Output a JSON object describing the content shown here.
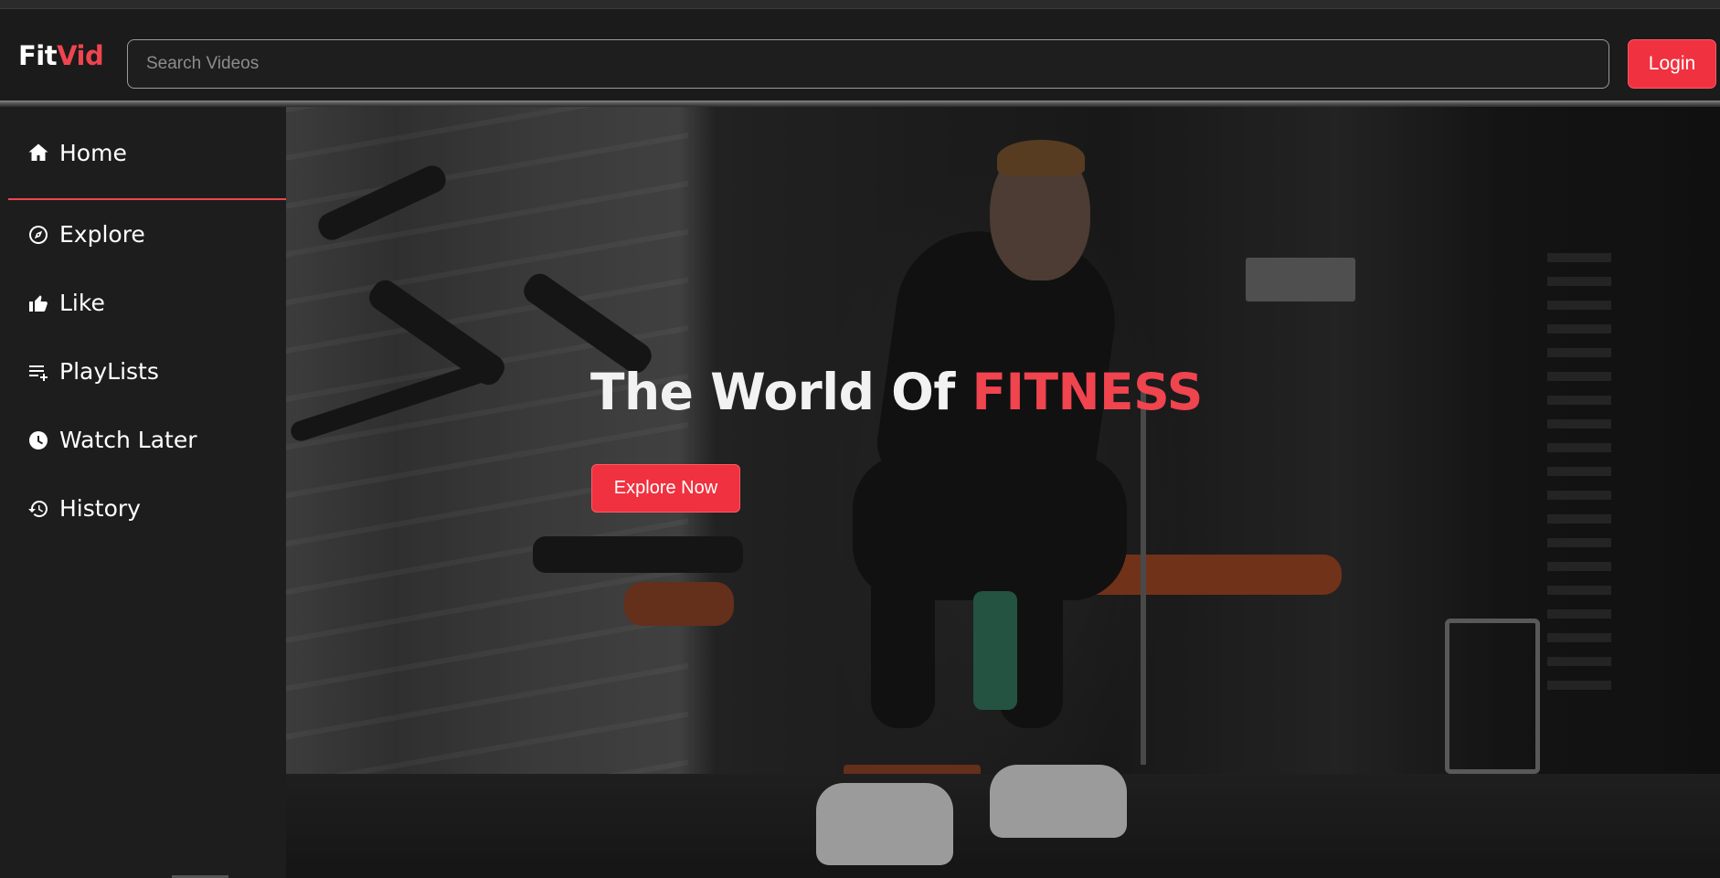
{
  "app": {
    "logo_part1": "Fit",
    "logo_part2": "Vid",
    "accent_color": "#f0444f",
    "button_color": "#f0313f"
  },
  "header": {
    "search_placeholder": "Search Videos",
    "search_value": "",
    "login_label": "Login"
  },
  "sidebar": {
    "items": [
      {
        "label": "Home",
        "icon": "home-icon",
        "active": true
      },
      {
        "label": "Explore",
        "icon": "compass-icon",
        "active": false
      },
      {
        "label": "Like",
        "icon": "thumbs-up-icon",
        "active": false
      },
      {
        "label": "PlayLists",
        "icon": "playlist-add-icon",
        "active": false
      },
      {
        "label": "Watch Later",
        "icon": "clock-icon",
        "active": false
      },
      {
        "label": "History",
        "icon": "history-icon",
        "active": false
      }
    ]
  },
  "hero": {
    "title_part1": "The World Of ",
    "title_part2": "FITNESS",
    "cta_label": "Explore Now"
  }
}
